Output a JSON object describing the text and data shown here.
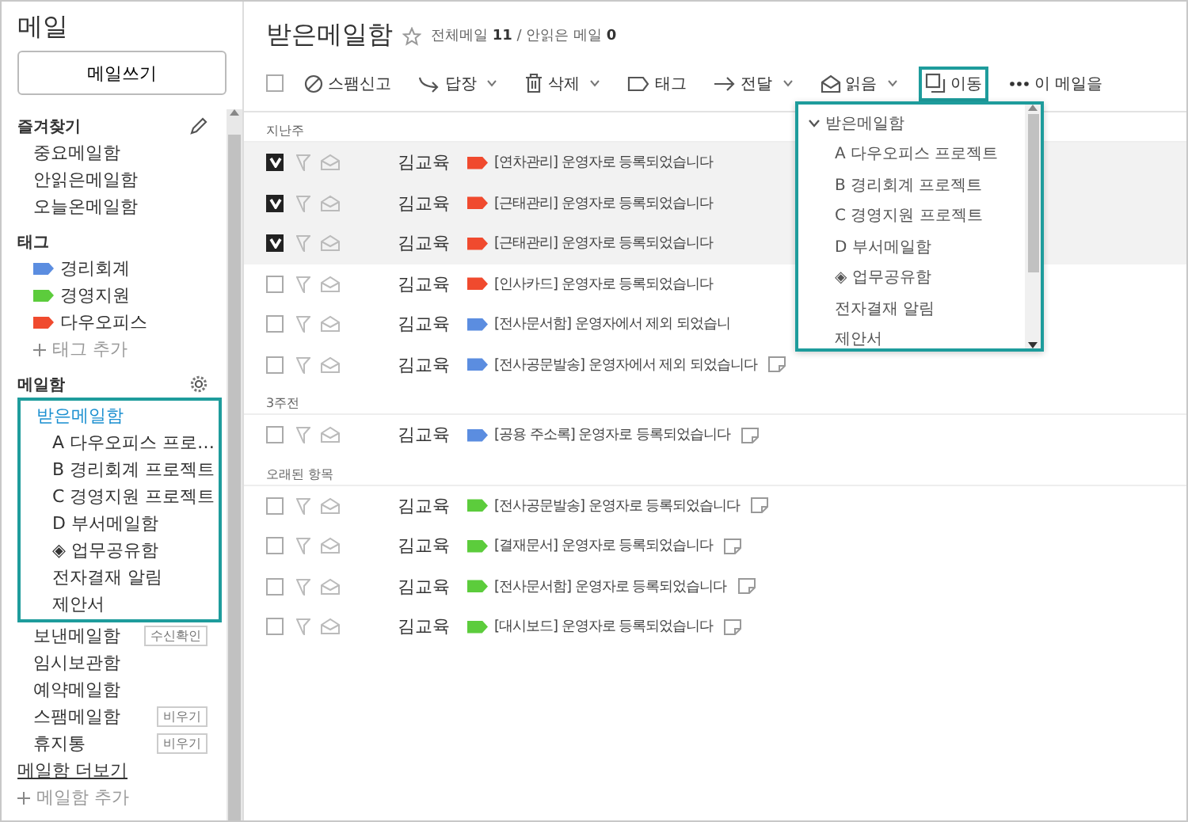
{
  "sidebar": {
    "title": "메일",
    "compose_button": "메일쓰기",
    "favorites": {
      "heading": "즐겨찾기",
      "items": [
        "중요메일함",
        "안읽은메일함",
        "오늘온메일함"
      ]
    },
    "tags": {
      "heading": "태그",
      "items": [
        {
          "label": "경리회계",
          "color": "#5b8de0"
        },
        {
          "label": "경영지원",
          "color": "#5ccc3c"
        },
        {
          "label": "다우오피스",
          "color": "#f04a2e"
        }
      ],
      "add_label": "태그 추가"
    },
    "mailboxes": {
      "heading": "메일함",
      "items": [
        {
          "label": "받은메일함",
          "selected": true,
          "children": [
            {
              "label": "A 다우오피스 프로…",
              "selected": false
            },
            {
              "label": "B 경리회계 프로젝트",
              "selected": false
            },
            {
              "label": "C 경영지원 프로젝트",
              "selected": false
            },
            {
              "label": "D 부서메일함",
              "selected": false
            },
            {
              "label": "◈ 업무공유함",
              "selected": false
            },
            {
              "label": "전자결재 알림",
              "selected": false
            },
            {
              "label": "제안서",
              "selected": false
            }
          ]
        },
        {
          "label": "보낸메일함",
          "selected": false,
          "action": "수신확인"
        },
        {
          "label": "임시보관함",
          "selected": false
        },
        {
          "label": "예약메일함",
          "selected": false
        },
        {
          "label": "스팸메일함",
          "selected": false,
          "action": "비우기"
        },
        {
          "label": "휴지통",
          "selected": false,
          "action": "비우기"
        }
      ],
      "more_link": "메일함 더보기",
      "add_label": "메일함 추가"
    }
  },
  "main": {
    "title": "받은메일함",
    "starred": false,
    "counts": "전체메일 **11** / 안읽은 메일 **0**",
    "toolbar": [
      {
        "kind": "checkbox",
        "checked": false
      },
      {
        "kind": "spam",
        "label": "스팸신고",
        "menu": false,
        "active": false
      },
      {
        "kind": "reply",
        "label": "답장",
        "menu": true,
        "active": false
      },
      {
        "kind": "delete",
        "label": "삭제",
        "menu": true,
        "active": false
      },
      {
        "kind": "tag",
        "label": "태그",
        "menu": false,
        "active": false
      },
      {
        "kind": "forward",
        "label": "전달",
        "menu": true,
        "active": false
      },
      {
        "kind": "read",
        "label": "읽음",
        "menu": true,
        "active": false
      },
      {
        "kind": "move",
        "label": "이동",
        "menu": false,
        "active": true
      },
      {
        "kind": "more",
        "label": "이 메일을",
        "menu": false,
        "active": false
      }
    ],
    "groups": [
      {
        "label": "지난주",
        "rows": [
          {
            "checked": true,
            "sender": "김교육",
            "color": "#f04a2e",
            "subject": "[연차관리] 운영자로 등록되었습니다"
          },
          {
            "checked": true,
            "sender": "김교육",
            "color": "#f04a2e",
            "subject": "[근태관리] 운영자로 등록되었습니다"
          },
          {
            "checked": true,
            "sender": "김교육",
            "color": "#f04a2e",
            "subject": "[근태관리] 운영자로 등록되었습니다"
          },
          {
            "checked": false,
            "sender": "김교육",
            "color": "#f04a2e",
            "subject": "[인사카드] 운영자로 등록되었습니다"
          },
          {
            "checked": false,
            "sender": "김교육",
            "color": "#5b8de0",
            "subject": "[전사문서함] 운영자에서 제외 되었습니"
          },
          {
            "checked": false,
            "sender": "김교육",
            "color": "#5b8de0",
            "subject": "[전사공문발송] 운영자에서 제외 되었습니다",
            "memo_icon": true
          }
        ]
      },
      {
        "label": "3주전",
        "rows": [
          {
            "checked": false,
            "sender": "김교육",
            "color": "#5b8de0",
            "subject": "[공용 주소록] 운영자로 등록되었습니다",
            "memo_icon": true
          }
        ]
      },
      {
        "label": "오래된 항목",
        "rows": [
          {
            "checked": false,
            "sender": "김교육",
            "color": "#5ccc3c",
            "subject": "[전사공문발송] 운영자로 등록되었습니다",
            "memo_icon": true
          },
          {
            "checked": false,
            "sender": "김교육",
            "color": "#5ccc3c",
            "subject": "[결재문서] 운영자로 등록되었습니다",
            "memo_icon": true
          },
          {
            "checked": false,
            "sender": "김교육",
            "color": "#5ccc3c",
            "subject": "[전사문서함] 운영자로 등록되었습니다",
            "memo_icon": true
          },
          {
            "checked": false,
            "sender": "김교육",
            "color": "#5ccc3c",
            "subject": "[대시보드] 운영자로 등록되었습니다",
            "memo_icon": true
          }
        ]
      }
    ],
    "move_menu": {
      "items": [
        {
          "label": "받은메일함",
          "expanded": true,
          "children": [
            {
              "label": "A 다우오피스 프로젝트"
            },
            {
              "label": "B 경리회계 프로젝트"
            },
            {
              "label": "C 경영지원 프로젝트"
            },
            {
              "label": "D 부서메일함"
            },
            {
              "label": "◈ 업무공유함"
            },
            {
              "label": "전자결재 알림"
            },
            {
              "label": "제안서"
            }
          ]
        }
      ]
    }
  }
}
